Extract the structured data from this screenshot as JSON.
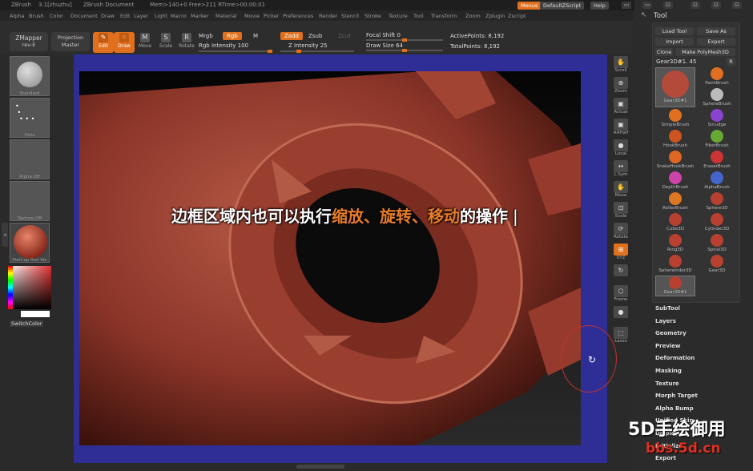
{
  "titlebar": {
    "app": "ZBrush",
    "version": "3.1[zhuzhu]",
    "doc": "ZBrush Document",
    "stats": "Mem>140+0 Free>211 RTime>00:00:01",
    "menus_btn": "Menus",
    "script_btn": "DefaultZScript",
    "help_btn": "Help"
  },
  "menubar": [
    "Alpha",
    "Brush",
    "Color",
    "Document",
    "Draw",
    "Edit",
    "Layer",
    "Light",
    "Macro",
    "Marker",
    "Material",
    "Movie",
    "Picker",
    "Preferences",
    "Render",
    "Stencil",
    "Stroke",
    "Texture",
    "Tool",
    "Transform",
    "Zoom",
    "Zplugin",
    "Zscript"
  ],
  "toolbar": {
    "zmapper": "ZMapper",
    "zmapper_sub": "rev-E",
    "projection": "Projection",
    "projection_sub": "Master",
    "edit": "Edit",
    "draw": "Draw",
    "move": "Move",
    "scale": "Scale",
    "rotate": "Rotate",
    "mrgb": "Mrgb",
    "rgb": "Rgb",
    "m": "M",
    "rgb_intensity": "Rgb Intensity 100",
    "zadd": "Zadd",
    "zsub": "Zsub",
    "zcut": "Zcut",
    "z_intensity": "Z Intensity 25",
    "focal_shift": "Focal Shift 0",
    "draw_size": "Draw Size 64",
    "active_points": "ActivePoints: 8,192",
    "total_points": "TotalPoints: 8,192",
    "rgb_intensity_value": 100,
    "z_intensity_value": 25,
    "focal_shift_value": 0,
    "draw_size_value": 64
  },
  "leftpanel": {
    "standard": "Standard",
    "dots": "Dots",
    "alpha": "Alpha Off",
    "texture": "Texture Off",
    "matcap": "MatCap Red Wa",
    "switchcolor": "SwitchColor"
  },
  "overlay": {
    "part1": "边框区域内也可以执行",
    "part2": "缩放、旋转、移动",
    "part3": "的操作"
  },
  "rightshelf": [
    "Scroll",
    "Zoom",
    "Actual",
    "AAHalf",
    "Local",
    "L.Sym",
    "Move",
    "Scale",
    "Rotate",
    "XYZ",
    "",
    "Frame",
    "",
    "Lasso"
  ],
  "rightpanel": {
    "title": "Tool",
    "load": "Load Tool",
    "save": "Save As",
    "import": "Import",
    "export": "Export",
    "clone": "Clone",
    "polymesh": "Make PolyMesh3D",
    "current": "Gear3D#1. 45",
    "r": "R",
    "tools": [
      {
        "name": "Gear3D#1",
        "color": "#b34a3a"
      },
      {
        "name": "PaintBrush",
        "color": "#e07020"
      },
      {
        "name": "SphereBrush",
        "color": "#bbbbbb"
      },
      {
        "name": "SimpleBrush",
        "color": "#e07020"
      },
      {
        "name": "Smudge",
        "color": "#8844cc"
      },
      {
        "name": "HookBrush",
        "color": "#cc5522"
      },
      {
        "name": "FiberBrush",
        "color": "#66aa33"
      },
      {
        "name": "SnakeHookBrush",
        "color": "#dd6622"
      },
      {
        "name": "EraserBrush",
        "color": "#cc3333"
      },
      {
        "name": "DepthBrush",
        "color": "#cc44aa"
      },
      {
        "name": "AlphaBrush",
        "color": "#4466cc"
      },
      {
        "name": "RollerBrush",
        "color": "#dd7722"
      },
      {
        "name": "Sphere3D",
        "color": "#b84030"
      },
      {
        "name": "Cube3D",
        "color": "#b84030"
      },
      {
        "name": "Cylinder3D",
        "color": "#b84030"
      },
      {
        "name": "Ring3D",
        "color": "#b84030"
      },
      {
        "name": "Spiral3D",
        "color": "#b84030"
      },
      {
        "name": "Sphereinder3D",
        "color": "#b84030"
      },
      {
        "name": "Gear3D",
        "color": "#b84030"
      },
      {
        "name": "Gear3D#1",
        "color": "#b84030"
      }
    ],
    "menus": [
      "SubTool",
      "Layers",
      "Geometry",
      "Preview",
      "Deformation",
      "Masking",
      "Texture",
      "Morph Target",
      "Alpha Bump",
      "Unified Skin",
      "Display",
      "Initialize",
      "Export"
    ]
  },
  "watermark": {
    "line1": "5D手绘御用",
    "line2": "bbs.5d.cn"
  },
  "colors": {
    "accent": "#e0701e",
    "frame": "#2e2e96",
    "model": "#a84838"
  }
}
